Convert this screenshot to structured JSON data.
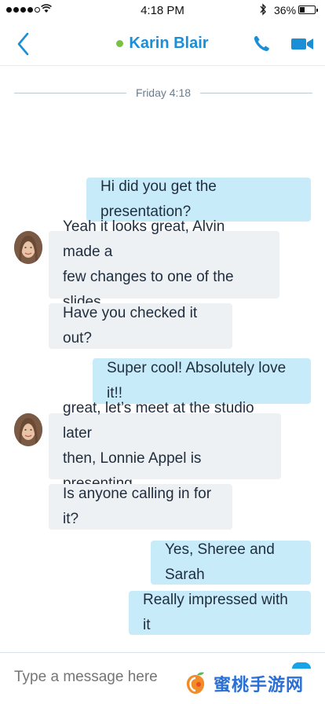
{
  "status_bar": {
    "time": "4:18 PM",
    "battery_pct": "36%",
    "battery_level": 0.36,
    "signal_bars": 4
  },
  "header": {
    "contact_name": "Karin Blair",
    "presence": "online",
    "accent_color": "#1a8fd6",
    "presence_color": "#7ac143",
    "icons": {
      "back": "chevron-left-icon",
      "call": "phone-icon",
      "video": "video-camera-icon"
    }
  },
  "divider": {
    "label": "Friday 4:18"
  },
  "messages": [
    {
      "direction": "out",
      "lines": [
        "Hi did you get the presentation?"
      ]
    },
    {
      "direction": "in",
      "lines": [
        "Yeah it looks great, Alvin made a",
        "few changes to one of the slides"
      ]
    },
    {
      "direction": "in",
      "lines": [
        "Have you checked it out?"
      ]
    },
    {
      "direction": "out",
      "lines": [
        "Super cool! Absolutely love it!!"
      ]
    },
    {
      "direction": "in",
      "lines": [
        "great, let’s meet at the studio later",
        "then, Lonnie Appel is presenting"
      ]
    },
    {
      "direction": "in",
      "lines": [
        "Is anyone calling in for it?"
      ]
    },
    {
      "direction": "out",
      "lines": [
        "Yes, Sheree and Sarah"
      ]
    },
    {
      "direction": "out",
      "lines": [
        "Really impressed with it"
      ]
    }
  ],
  "compose": {
    "placeholder": "Type a message here",
    "watermark": "蜜桃手游网"
  },
  "colors": {
    "outgoing_bubble": "#c8ebfa",
    "incoming_bubble": "#eef1f4"
  }
}
